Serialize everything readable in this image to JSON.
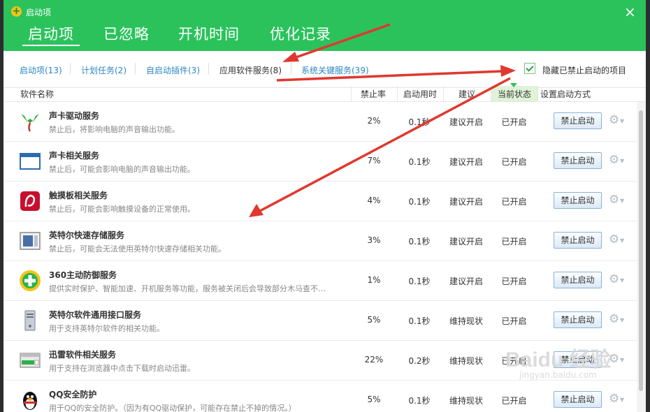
{
  "window": {
    "title": "启动项",
    "close": "×"
  },
  "main_tabs": [
    {
      "label": "启动项"
    },
    {
      "label": "已忽略"
    },
    {
      "label": "开机时间"
    },
    {
      "label": "优化记录"
    }
  ],
  "sub_tabs": [
    {
      "label": "启动项(13)"
    },
    {
      "label": "计划任务(2)"
    },
    {
      "label": "自启动插件(3)"
    },
    {
      "label": "应用软件服务(8)"
    },
    {
      "label": "系统关键服务(39)"
    }
  ],
  "hide_disabled": {
    "label": "隐藏已禁止启动的项目",
    "checked": true
  },
  "columns": {
    "name": "软件名称",
    "rate": "禁止率",
    "time": "启动用时",
    "suggestion": "建议",
    "status": "当前状态",
    "setting": "设置启动方式"
  },
  "rows": [
    {
      "name": "声卡驱动服务",
      "desc": "禁止后，将影响电脑的声音输出功能。",
      "rate": "2%",
      "time": "0.1秒",
      "suggestion": "建议开启",
      "status": "已开启",
      "button": "禁止启动",
      "icon": "sound-driver-icon"
    },
    {
      "name": "声卡相关服务",
      "desc": "禁止后，可能会影响电脑的声音输出功能。",
      "rate": "7%",
      "time": "0.1秒",
      "suggestion": "建议开启",
      "status": "已开启",
      "button": "禁止启动",
      "icon": "window-app-icon"
    },
    {
      "name": "触摸板相关服务",
      "desc": "禁止后，可能会影响触摸设备的正常使用。",
      "rate": "4%",
      "time": "0.1秒",
      "suggestion": "建议开启",
      "status": "已开启",
      "button": "禁止启动",
      "icon": "touchpad-icon"
    },
    {
      "name": "英特尔快速存储服务",
      "desc": "禁止后，可能会无法使用英特尔快速存储相关功能。",
      "rate": "3%",
      "time": "0.1秒",
      "suggestion": "建议开启",
      "status": "已开启",
      "button": "禁止启动",
      "icon": "intel-storage-icon"
    },
    {
      "name": "360主动防御服务",
      "desc": "提供实时保护、智能加速、开机服务等功能，服务被关闭后会导致部分木马查不…",
      "rate": "1%",
      "time": "0.1秒",
      "suggestion": "建议开启",
      "status": "已开启",
      "button": "禁止启动",
      "icon": "360-shield-icon"
    },
    {
      "name": "英特尔软件通用接口服务",
      "desc": "用于支持英特尔软件的相关功能。",
      "rate": "5%",
      "time": "0.1秒",
      "suggestion": "维持现状",
      "status": "已开启",
      "button": "禁止启动",
      "icon": "server-icon"
    },
    {
      "name": "迅雷软件相关服务",
      "desc": "用于支持在浏览器中点击下载时启动迅雷。",
      "rate": "22%",
      "time": "0.2秒",
      "suggestion": "维持现状",
      "status": "已开启",
      "button": "禁止启动",
      "icon": "download-drive-icon"
    },
    {
      "name": "QQ安全防护",
      "desc": "用于QQ的安全防护。（因为有QQ驱动保护，可能存在禁止不掉的情况。）",
      "rate": "5%",
      "time": "0.1秒",
      "suggestion": "维持现状",
      "status": "已开启",
      "button": "禁止启动",
      "icon": "qq-penguin-icon"
    }
  ],
  "watermark": {
    "logo": "Baidu 经验",
    "url": "jingyan.baidu.com"
  },
  "colors": {
    "header_green": "#2bc25c",
    "link_blue": "#2b87c4",
    "annotation_red": "#e0382f"
  }
}
